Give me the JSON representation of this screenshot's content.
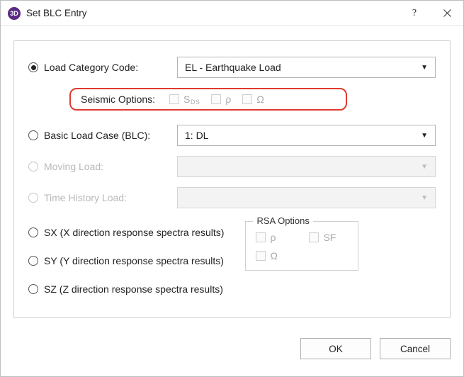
{
  "window": {
    "icon_label": "3D",
    "title": "Set BLC Entry",
    "help_glyph": "?"
  },
  "options": {
    "load_category": {
      "label": "Load Category Code:",
      "value": "EL - Earthquake Load"
    },
    "seismic": {
      "label": "Seismic Options:",
      "sds": "S",
      "sds_sub": "DS",
      "rho": "ρ",
      "omega": "Ω"
    },
    "blc": {
      "label": "Basic Load Case (BLC):",
      "value": "1: DL"
    },
    "moving": {
      "label": "Moving Load:",
      "value": ""
    },
    "time_history": {
      "label": "Time History Load:",
      "value": ""
    },
    "sx": "SX (X direction response spectra results)",
    "sy": "SY (Y direction response spectra results)",
    "sz": "SZ (Z direction response spectra results)",
    "rsa": {
      "legend": "RSA Options",
      "rho": "ρ",
      "sf": "SF",
      "omega": "Ω"
    }
  },
  "buttons": {
    "ok": "OK",
    "cancel": "Cancel"
  }
}
